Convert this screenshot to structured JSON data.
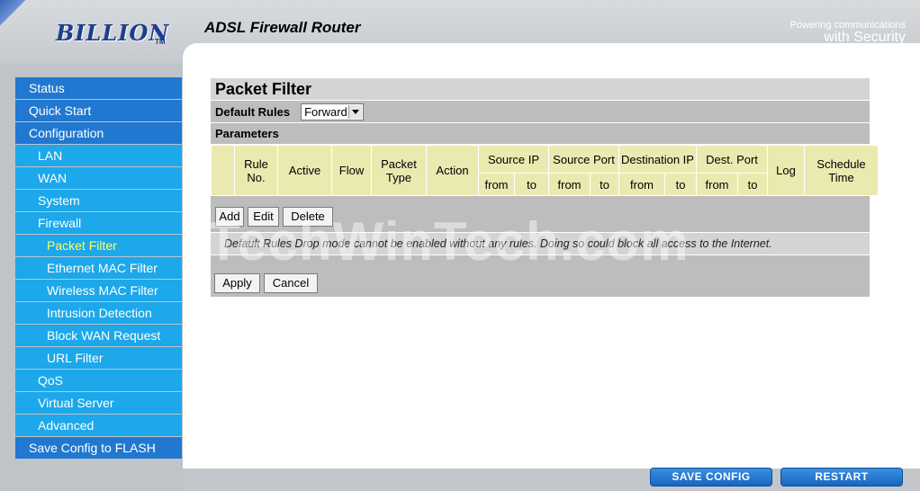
{
  "header": {
    "logo": "BILLION",
    "logo_tm": "TM",
    "title": "ADSL Firewall Router",
    "tagline_line1": "Powering communications",
    "tagline_line2": "with Security"
  },
  "sidebar": {
    "items": [
      {
        "label": "Status",
        "level": 0
      },
      {
        "label": "Quick Start",
        "level": 0
      },
      {
        "label": "Configuration",
        "level": 0
      },
      {
        "label": "LAN",
        "level": 1
      },
      {
        "label": "WAN",
        "level": 1
      },
      {
        "label": "System",
        "level": 1
      },
      {
        "label": "Firewall",
        "level": 1
      },
      {
        "label": "Packet Filter",
        "level": 2,
        "selected": true
      },
      {
        "label": "Ethernet MAC Filter",
        "level": 2
      },
      {
        "label": "Wireless MAC Filter",
        "level": 2
      },
      {
        "label": "Intrusion Detection",
        "level": 2
      },
      {
        "label": "Block WAN Request",
        "level": 2
      },
      {
        "label": "URL Filter",
        "level": 2
      },
      {
        "label": "QoS",
        "level": 1
      },
      {
        "label": "Virtual Server",
        "level": 1
      },
      {
        "label": "Advanced",
        "level": 1
      },
      {
        "label": "Save Config to FLASH",
        "level": 0
      }
    ]
  },
  "panel": {
    "title": "Packet Filter",
    "default_rules_label": "Default Rules",
    "default_rules_value": "Forward",
    "parameters_label": "Parameters",
    "columns": {
      "rule_no": "Rule No.",
      "active": "Active",
      "flow": "Flow",
      "packet_type": "Packet Type",
      "action": "Action",
      "source_ip": "Source IP",
      "source_port": "Source Port",
      "destination_ip": "Destination IP",
      "dest_port": "Dest. Port",
      "log": "Log",
      "schedule_time": "Schedule Time",
      "from": "from",
      "to": "to"
    },
    "buttons": {
      "add": "Add",
      "edit": "Edit",
      "delete": "Delete",
      "apply": "Apply",
      "cancel": "Cancel"
    },
    "note": "Default Rules Drop mode cannot be enabled without any rules. Doing so could block all access to the Internet."
  },
  "footer": {
    "save_config": "SAVE CONFIG",
    "restart": "RESTART"
  },
  "watermark": "TechWinTech.com",
  "colors": {
    "nav_primary": "#2178d0",
    "nav_secondary": "#1ca8ea",
    "selected_text": "#ffff66",
    "table_cell": "#eaeab0"
  }
}
